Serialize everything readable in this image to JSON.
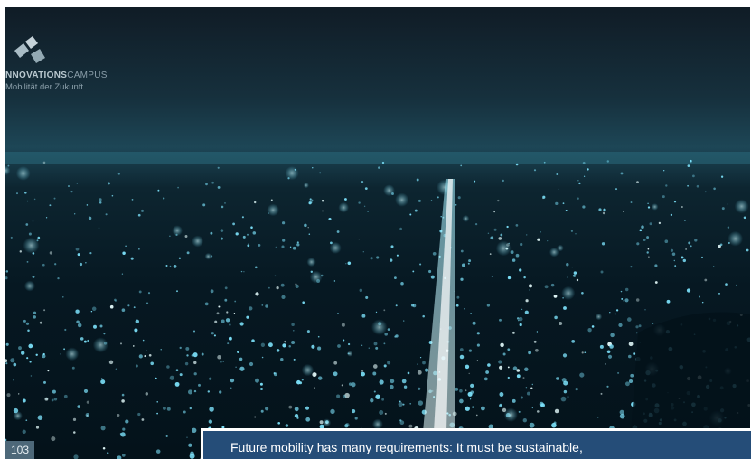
{
  "photo": {
    "subject": "city-skyline-at-night-icon"
  },
  "logo": {
    "name_bold": "NNOVATIONS",
    "name_light": "CAMPUS",
    "tagline": "Mobilität der Zukunft"
  },
  "page": {
    "number": "103"
  },
  "caption": {
    "text": "Future mobility has many requirements: It must be sustainable,"
  },
  "colors": {
    "caption_background": "#254d78",
    "page_number_background": "#4d6879",
    "city_lights": "#7fe6ff"
  }
}
